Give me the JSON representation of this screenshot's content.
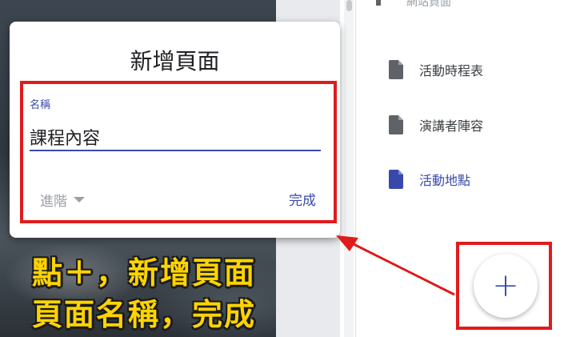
{
  "dialog": {
    "title": "新增頁面",
    "field_label": "名稱",
    "field_value": "課程內容",
    "advanced_label": "進階",
    "done_label": "完成"
  },
  "sidebar": {
    "cut_off_item": "網站頁面",
    "items": [
      {
        "label": "活動時程表",
        "active": false
      },
      {
        "label": "演講者陣容",
        "active": false
      },
      {
        "label": "活動地點",
        "active": true
      }
    ]
  },
  "fab": {
    "symbol": "+"
  },
  "annotation": {
    "line1": "點＋，新增頁面",
    "line2": "頁面名稱，完成"
  },
  "colors": {
    "accent": "#3949ab",
    "highlight": "#e01b1b",
    "caption": "#ffd400"
  }
}
